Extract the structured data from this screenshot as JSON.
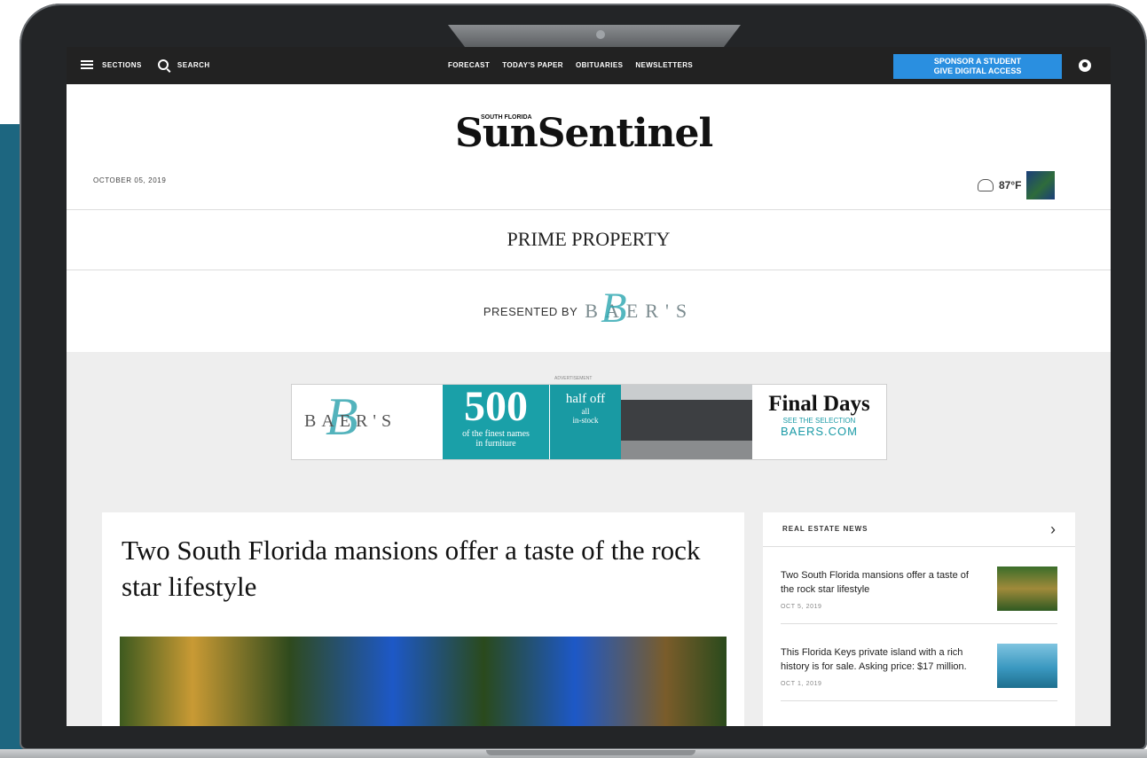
{
  "nav": {
    "sections_label": "SECTIONS",
    "search_label": "SEARCH",
    "links": [
      "FORECAST",
      "TODAY'S PAPER",
      "OBITUARIES",
      "NEWSLETTERS"
    ],
    "sponsor_line1": "SPONSOR A STUDENT",
    "sponsor_line2": "GIVE DIGITAL ACCESS"
  },
  "masthead": {
    "logo_sub": "SOUTH FLORIDA",
    "logo": "SunSentinel",
    "date": "OCTOBER 05, 2019",
    "temperature": "87°F"
  },
  "section": {
    "title": "PRIME PROPERTY",
    "presented_by": "PRESENTED BY",
    "sponsor_logo": "BAER'S"
  },
  "ad": {
    "label": "ADVERTISEMENT",
    "logo_text": "BAER'S",
    "big_number": "500",
    "number_caption1": "of the finest names",
    "number_caption2": "in furniture",
    "half_off": "half off",
    "half_sub1": "all",
    "half_sub2": "in-stock",
    "final": "Final Days",
    "see": "SEE THE SELECTION",
    "url": "BAERS.COM"
  },
  "article": {
    "headline": "Two South Florida mansions offer a taste of the rock star lifestyle"
  },
  "sidebar": {
    "title": "REAL ESTATE NEWS",
    "items": [
      {
        "title": "Two South Florida mansions offer a taste of the rock star lifestyle",
        "date": "OCT 5, 2019"
      },
      {
        "title": "This Florida Keys private island with a rich history is for sale. Asking price: $17 million.",
        "date": "OCT 1, 2019"
      }
    ]
  },
  "colors": {
    "accent": "#2a8fe0",
    "teal": "#1aa0a8",
    "nav_bg": "#222222"
  }
}
